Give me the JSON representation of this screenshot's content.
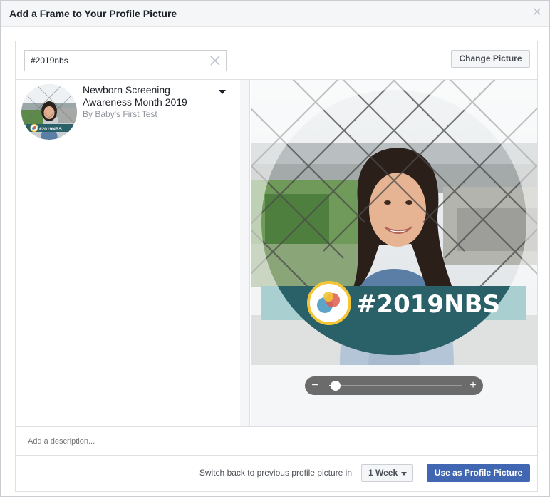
{
  "dialog": {
    "title": "Add a Frame to Your Profile Picture",
    "close_icon": "close-icon"
  },
  "toolbar": {
    "search_value": "#2019nbs",
    "clear_icon": "clear-x-icon",
    "change_picture_label": "Change Picture"
  },
  "frames": [
    {
      "title": "Newborn Screening Awareness Month 2019",
      "author": "By Baby's First Test",
      "thumb_badge": "#2019NBS",
      "menu_icon": "caret-down-icon"
    }
  ],
  "preview": {
    "overlay_text": "#2019NBS",
    "banner_color": "#2a6068",
    "banner_light_color": "#a9cfd0",
    "logo_ring_color": "#f3c537"
  },
  "zoom": {
    "minus_label": "−",
    "plus_label": "+",
    "level": 0.05
  },
  "description": {
    "placeholder": "Add a description..."
  },
  "footer": {
    "switch_back_label": "Switch back to previous profile picture in",
    "duration_value": "1 Week",
    "use_button_label": "Use as Profile Picture",
    "accent_color": "#4267b2"
  }
}
